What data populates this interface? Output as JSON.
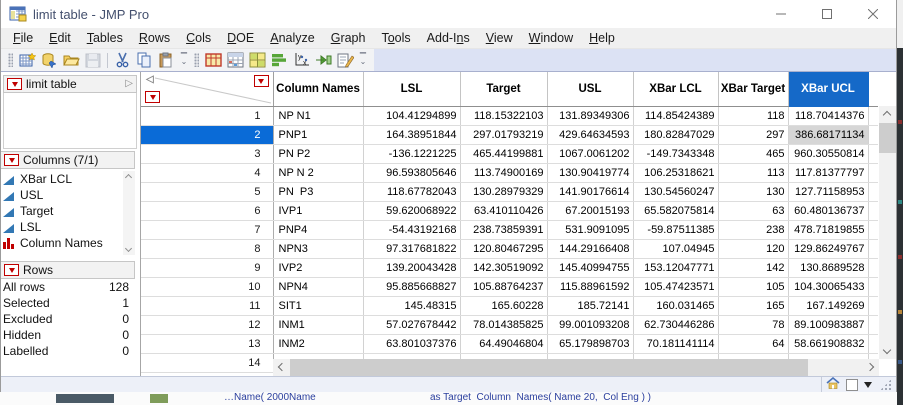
{
  "window": {
    "title": "limit table - JMP Pro"
  },
  "menu": {
    "items": [
      {
        "label": "File",
        "u": 0
      },
      {
        "label": "Edit",
        "u": 0
      },
      {
        "label": "Tables",
        "u": 0
      },
      {
        "label": "Rows",
        "u": 0
      },
      {
        "label": "Cols",
        "u": 0
      },
      {
        "label": "DOE",
        "u": 0
      },
      {
        "label": "Analyze",
        "u": 0
      },
      {
        "label": "Graph",
        "u": 0
      },
      {
        "label": "Tools",
        "u": 1
      },
      {
        "label": "Add-Ins",
        "u": 5
      },
      {
        "label": "View",
        "u": 0
      },
      {
        "label": "Window",
        "u": 0
      },
      {
        "label": "Help",
        "u": 0
      }
    ]
  },
  "toolbar": {
    "icons": [
      "new-data-table",
      "open-database",
      "open-file",
      "save",
      "cut",
      "copy",
      "paste",
      "data-table",
      "journal",
      "new-window",
      "graph-builder",
      "fit-y-by-x",
      "formula",
      "script-editor"
    ]
  },
  "sidebar": {
    "table_panel": {
      "title": "limit table"
    },
    "columns_panel": {
      "title": "Columns (7/1)",
      "items": [
        {
          "label": "Column Names",
          "type": "nominal"
        },
        {
          "label": "LSL",
          "type": "continuous"
        },
        {
          "label": "Target",
          "type": "continuous"
        },
        {
          "label": "USL",
          "type": "continuous"
        },
        {
          "label": "XBar LCL",
          "type": "continuous"
        }
      ]
    },
    "rows_panel": {
      "title": "Rows",
      "stats": [
        {
          "label": "All rows",
          "value": "128"
        },
        {
          "label": "Selected",
          "value": "1"
        },
        {
          "label": "Excluded",
          "value": "0"
        },
        {
          "label": "Hidden",
          "value": "0"
        },
        {
          "label": "Labelled",
          "value": "0"
        }
      ]
    }
  },
  "table": {
    "columns": [
      {
        "label": "Column Names",
        "align": "left",
        "selected": false
      },
      {
        "label": "LSL",
        "align": "right",
        "selected": false
      },
      {
        "label": "Target",
        "align": "right",
        "selected": false
      },
      {
        "label": "USL",
        "align": "right",
        "selected": false
      },
      {
        "label": "XBar LCL",
        "align": "right",
        "selected": false
      },
      {
        "label": "XBar Target",
        "align": "right",
        "selected": false
      },
      {
        "label": "XBar UCL",
        "align": "right",
        "selected": true
      }
    ],
    "selected_row": "2",
    "selected_cell": {
      "row": "2",
      "column": "XBar UCL"
    },
    "rows": [
      {
        "n": "1",
        "cells": [
          "NP N1",
          "104.41294899",
          "118.15322103",
          "131.89349306",
          "114.85424389",
          "118",
          "118.70414376"
        ]
      },
      {
        "n": "2",
        "cells": [
          "PNP1",
          "164.38951844",
          "297.01793219",
          "429.64634593",
          "180.82847029",
          "297",
          "386.68171134"
        ]
      },
      {
        "n": "3",
        "cells": [
          "PN P2",
          "-136.1221225",
          "465.44199881",
          "1067.0061202",
          "-149.7343348",
          "465",
          "960.30550814"
        ]
      },
      {
        "n": "4",
        "cells": [
          "NP N 2",
          "96.593805646",
          "113.74900169",
          "130.90419774",
          "106.25318621",
          "113",
          "117.81377797"
        ]
      },
      {
        "n": "5",
        "cells": [
          "PN  P3",
          "118.67782043",
          "130.28979329",
          "141.90176614",
          "130.54560247",
          "130",
          "127.71158953"
        ]
      },
      {
        "n": "6",
        "cells": [
          "IVP1",
          "59.620068922",
          "63.410110426",
          "67.20015193",
          "65.582075814",
          "63",
          "60.480136737"
        ]
      },
      {
        "n": "7",
        "cells": [
          "PNP4",
          "-54.43192168",
          "238.73859391",
          "531.9091095",
          "-59.87511385",
          "238",
          "478.71819855"
        ]
      },
      {
        "n": "8",
        "cells": [
          "NPN3",
          "97.317681822",
          "120.80467295",
          "144.29166408",
          "107.04945",
          "120",
          "129.86249767"
        ]
      },
      {
        "n": "9",
        "cells": [
          "IVP2",
          "139.20043428",
          "142.30519092",
          "145.40994755",
          "153.12047771",
          "142",
          "130.8689528"
        ]
      },
      {
        "n": "10",
        "cells": [
          "NPN4",
          "95.885668827",
          "105.88764237",
          "115.88961592",
          "105.47423571",
          "105",
          "104.30065433"
        ]
      },
      {
        "n": "11",
        "cells": [
          "SIT1",
          "145.48315",
          "165.60228",
          "185.72141",
          "160.031465",
          "165",
          "167.149269"
        ]
      },
      {
        "n": "12",
        "cells": [
          "INM1",
          "57.027678442",
          "78.014385825",
          "99.001093208",
          "62.730446286",
          "78",
          "89.100983887"
        ]
      },
      {
        "n": "13",
        "cells": [
          "INM2",
          "63.801037376",
          "64.49046804",
          "65.179898703",
          "70.181141114",
          "64",
          "58.661908832"
        ]
      },
      {
        "n": "14",
        "cells": [
          "",
          "",
          "",
          "",
          "",
          "",
          ""
        ]
      }
    ]
  },
  "colors": {
    "header_selected": "#1569c8",
    "row_selected": "#0a6bd7",
    "red_triangle": "#c00000",
    "continuous_icon": "#3278b4"
  },
  "background": {
    "fragments": [
      "…Name( 2000Name",
      "as Target  Column  Names( Name 20,  Col Eng ) )"
    ]
  }
}
